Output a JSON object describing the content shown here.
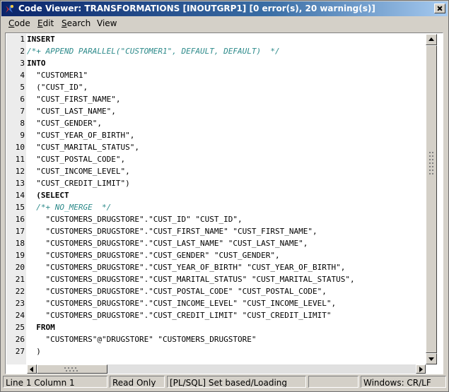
{
  "window": {
    "title": "Code Viewer: TRANSFORMATIONS [INOUTGRP1] [0 error(s), 20 warning(s)]"
  },
  "menu": [
    {
      "mnemonic": "C",
      "rest": "ode"
    },
    {
      "mnemonic": "E",
      "rest": "dit"
    },
    {
      "mnemonic": "S",
      "rest": "earch"
    },
    {
      "mnemonic": "",
      "rest": "View"
    }
  ],
  "editor": {
    "lines": [
      {
        "num": "1",
        "text": "INSERT",
        "style": "kw"
      },
      {
        "num": "2",
        "text": "/*+ APPEND PARALLEL(\"CUSTOMER1\", DEFAULT, DEFAULT)  */",
        "style": "cm"
      },
      {
        "num": "3",
        "text": "INTO",
        "style": "kw"
      },
      {
        "num": "4",
        "text": "  \"CUSTOMER1\"",
        "style": ""
      },
      {
        "num": "5",
        "text": "  (\"CUST_ID\",",
        "style": ""
      },
      {
        "num": "6",
        "text": "  \"CUST_FIRST_NAME\",",
        "style": ""
      },
      {
        "num": "7",
        "text": "  \"CUST_LAST_NAME\",",
        "style": ""
      },
      {
        "num": "8",
        "text": "  \"CUST_GENDER\",",
        "style": ""
      },
      {
        "num": "9",
        "text": "  \"CUST_YEAR_OF_BIRTH\",",
        "style": ""
      },
      {
        "num": "10",
        "text": "  \"CUST_MARITAL_STATUS\",",
        "style": ""
      },
      {
        "num": "11",
        "text": "  \"CUST_POSTAL_CODE\",",
        "style": ""
      },
      {
        "num": "12",
        "text": "  \"CUST_INCOME_LEVEL\",",
        "style": ""
      },
      {
        "num": "13",
        "text": "  \"CUST_CREDIT_LIMIT\")",
        "style": ""
      },
      {
        "num": "14",
        "text": "  (SELECT",
        "style": "kw"
      },
      {
        "num": "15",
        "text": "  /*+ NO_MERGE  */",
        "style": "cm"
      },
      {
        "num": "16",
        "text": "    \"CUSTOMERS_DRUGSTORE\".\"CUST_ID\" \"CUST_ID\",",
        "style": ""
      },
      {
        "num": "17",
        "text": "    \"CUSTOMERS_DRUGSTORE\".\"CUST_FIRST_NAME\" \"CUST_FIRST_NAME\",",
        "style": ""
      },
      {
        "num": "18",
        "text": "    \"CUSTOMERS_DRUGSTORE\".\"CUST_LAST_NAME\" \"CUST_LAST_NAME\",",
        "style": ""
      },
      {
        "num": "19",
        "text": "    \"CUSTOMERS_DRUGSTORE\".\"CUST_GENDER\" \"CUST_GENDER\",",
        "style": ""
      },
      {
        "num": "20",
        "text": "    \"CUSTOMERS_DRUGSTORE\".\"CUST_YEAR_OF_BIRTH\" \"CUST_YEAR_OF_BIRTH\",",
        "style": ""
      },
      {
        "num": "21",
        "text": "    \"CUSTOMERS_DRUGSTORE\".\"CUST_MARITAL_STATUS\" \"CUST_MARITAL_STATUS\",",
        "style": ""
      },
      {
        "num": "22",
        "text": "    \"CUSTOMERS_DRUGSTORE\".\"CUST_POSTAL_CODE\" \"CUST_POSTAL_CODE\",",
        "style": ""
      },
      {
        "num": "23",
        "text": "    \"CUSTOMERS_DRUGSTORE\".\"CUST_INCOME_LEVEL\" \"CUST_INCOME_LEVEL\",",
        "style": ""
      },
      {
        "num": "24",
        "text": "    \"CUSTOMERS_DRUGSTORE\".\"CUST_CREDIT_LIMIT\" \"CUST_CREDIT_LIMIT\"",
        "style": ""
      },
      {
        "num": "25",
        "text": "  FROM",
        "style": "kw"
      },
      {
        "num": "26",
        "text": "    \"CUSTOMERS\"@\"DRUGSTORE\" \"CUSTOMERS_DRUGSTORE\"",
        "style": ""
      },
      {
        "num": "27",
        "text": "  )",
        "style": ""
      }
    ]
  },
  "status": {
    "position": "Line 1 Column 1",
    "mode": "Read Only",
    "language": "[PL/SQL] Set based/Loading",
    "extra": "",
    "line_endings": "Windows: CR/LF"
  },
  "colors": {
    "comment": "#2e8b8b",
    "title_start": "#0a246a",
    "title_end": "#a6caf0"
  }
}
